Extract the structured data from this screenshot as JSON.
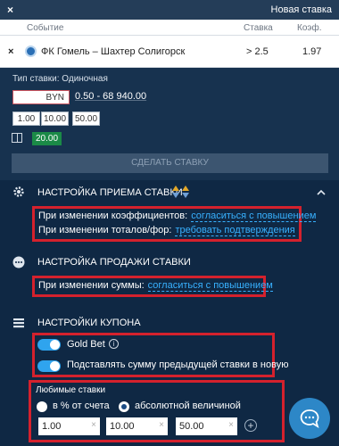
{
  "topbar": {
    "close": "×",
    "title": "Новая ставка"
  },
  "bet_table": {
    "columns": {
      "event": "Событие",
      "stake": "Ставка",
      "odds": "Коэф."
    },
    "row": {
      "remove": "×",
      "event": "ФК Гомель – Шахтер Солигорск",
      "stake": "> 2.5",
      "odds": "1.97"
    }
  },
  "stake_panel": {
    "type_label": "Тип ставки: Одиночная",
    "currency": "BYN",
    "range": "0.50 - 68 940.00",
    "quick": [
      "1.00",
      "10.00",
      "50.00"
    ],
    "bonus": "20.00",
    "submit": "СДЕЛАТЬ СТАВКУ"
  },
  "settings_accept": {
    "title": "НАСТРОЙКА ПРИЕМА СТАВКИ",
    "odds_key": "При изменении коэффициентов:",
    "odds_val": "согласиться с повышением",
    "totals_key": "При изменении тоталов/фор:",
    "totals_val": "требовать подтверждения"
  },
  "settings_sell": {
    "title": "НАСТРОЙКА ПРОДАЖИ СТАВКИ",
    "amount_key": "При изменении суммы:",
    "amount_val": "согласиться с повышением"
  },
  "settings_coupon": {
    "title": "НАСТРОЙКИ КУПОНА",
    "goldbet": "Gold Bet",
    "prev_sum": "Подставлять сумму предыдущей ставки в новую",
    "favorites_title": "Любимые ставки",
    "radio_percent": "в % от счета",
    "radio_absolute": "абсолютной величиной",
    "values": [
      "1.00",
      "10.00",
      "50.00"
    ]
  },
  "colors": {
    "accent": "#38b1ff",
    "highlight": "#d4212d",
    "bg": "#0f2844"
  }
}
